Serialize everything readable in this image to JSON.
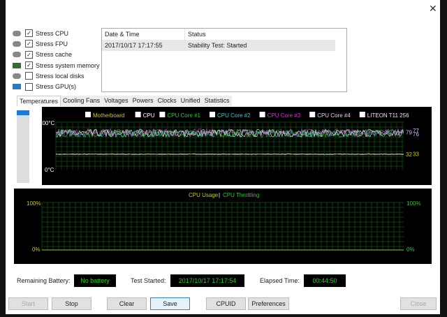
{
  "window": {
    "close_glyph": "✕"
  },
  "stress_options": [
    {
      "label": "Stress CPU",
      "checked": true,
      "icon": "cpu-icon"
    },
    {
      "label": "Stress FPU",
      "checked": true,
      "icon": "fpu-icon"
    },
    {
      "label": "Stress cache",
      "checked": true,
      "icon": "cache-icon"
    },
    {
      "label": "Stress system memory",
      "checked": true,
      "icon": "memory-icon"
    },
    {
      "label": "Stress local disks",
      "checked": false,
      "icon": "disk-icon"
    },
    {
      "label": "Stress GPU(s)",
      "checked": false,
      "icon": "gpu-icon"
    }
  ],
  "log": {
    "headers": [
      "Date & Time",
      "Status"
    ],
    "rows": [
      {
        "time": "2017/10/17 17:17:55",
        "status": "Stability Test: Started"
      }
    ]
  },
  "tabs": [
    "Temperatures",
    "Cooling Fans",
    "Voltages",
    "Powers",
    "Clocks",
    "Unified",
    "Statistics"
  ],
  "active_tab": "Temperatures",
  "chart_data": [
    {
      "type": "line",
      "ylim": [
        0,
        100
      ],
      "y_top_label": "100°C",
      "y_bottom_label": "0°C",
      "grid": true,
      "series": [
        {
          "name": "Motherboard",
          "color": "#c8c832",
          "level": 32
        },
        {
          "name": "CPU",
          "color": "#ffffff",
          "level": 77
        },
        {
          "name": "CPU Core #1",
          "color": "#2ec82e",
          "level": 76
        },
        {
          "name": "CPU Core #2",
          "color": "#3cc8c8",
          "level": 77
        },
        {
          "name": "CPU Core #3",
          "color": "#c83cc8",
          "level": 79
        },
        {
          "name": "CPU Core #4",
          "color": "#dddddd",
          "level": 77
        },
        {
          "name": "LITEON T11 256",
          "color": "#e8e8e8",
          "level": 33
        }
      ],
      "end_labels": [
        "79",
        "77",
        "76",
        "32",
        "33"
      ]
    },
    {
      "type": "line",
      "title_left": "CPU Usage",
      "title_sep": "|",
      "title_right": "CPU Throttling",
      "ylim": [
        0,
        100
      ],
      "y_top_label": "100%",
      "y_bottom_label": "0%",
      "grid": true,
      "colors": {
        "usage": "#c8c832",
        "throttling": "#2ec82e"
      }
    }
  ],
  "status": {
    "battery_label": "Remaining Battery:",
    "battery_value": "No battery",
    "started_label": "Test Started:",
    "started_value": "2017/10/17 17:17:54",
    "elapsed_label": "Elapsed Time:",
    "elapsed_value": "00:44:50"
  },
  "buttons": {
    "start": "Start",
    "stop": "Stop",
    "clear": "Clear",
    "save": "Save",
    "cpuid": "CPUID",
    "preferences": "Preferences",
    "close": "Close"
  }
}
